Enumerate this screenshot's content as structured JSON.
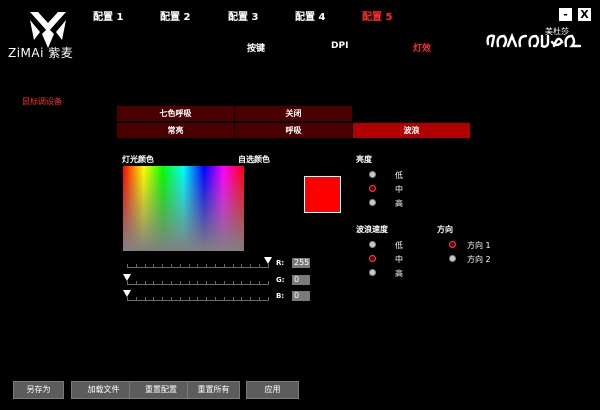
{
  "brand": {
    "name": "ZiMAi 紫麦",
    "product": "美杜莎"
  },
  "tabs": [
    {
      "label": "配置 1"
    },
    {
      "label": "配置 2"
    },
    {
      "label": "配置 3"
    },
    {
      "label": "配置 4"
    },
    {
      "label": "配置 5"
    }
  ],
  "subtabs": [
    {
      "label": "按键"
    },
    {
      "label": "DPI"
    },
    {
      "label": "灯效"
    }
  ],
  "window": {
    "minimize": "-",
    "close": "X"
  },
  "device": "鼠标调设备",
  "modes": {
    "row1": [
      "七色呼吸",
      "关闭"
    ],
    "row2": [
      "常亮",
      "呼吸",
      "波浪"
    ]
  },
  "sections": {
    "light_color": "灯光颜色",
    "custom_color": "自选颜色",
    "brightness": "亮度",
    "wave_speed": "波浪速度",
    "direction": "方向"
  },
  "rgb": {
    "r_label": "R:",
    "g_label": "G:",
    "b_label": "B:",
    "r": "255",
    "g": "0",
    "b": "0"
  },
  "brightness_options": [
    "低",
    "中",
    "高"
  ],
  "speed_options": [
    "低",
    "中",
    "高"
  ],
  "direction_options": [
    "方向 1",
    "方向 2"
  ],
  "buttons": [
    "另存为",
    "加载文件",
    "重置配置",
    "重置所有",
    "应用"
  ],
  "colors": {
    "accent": "#ff2d2d",
    "selected_cell": "#b20000",
    "cell": "#4a0000"
  }
}
